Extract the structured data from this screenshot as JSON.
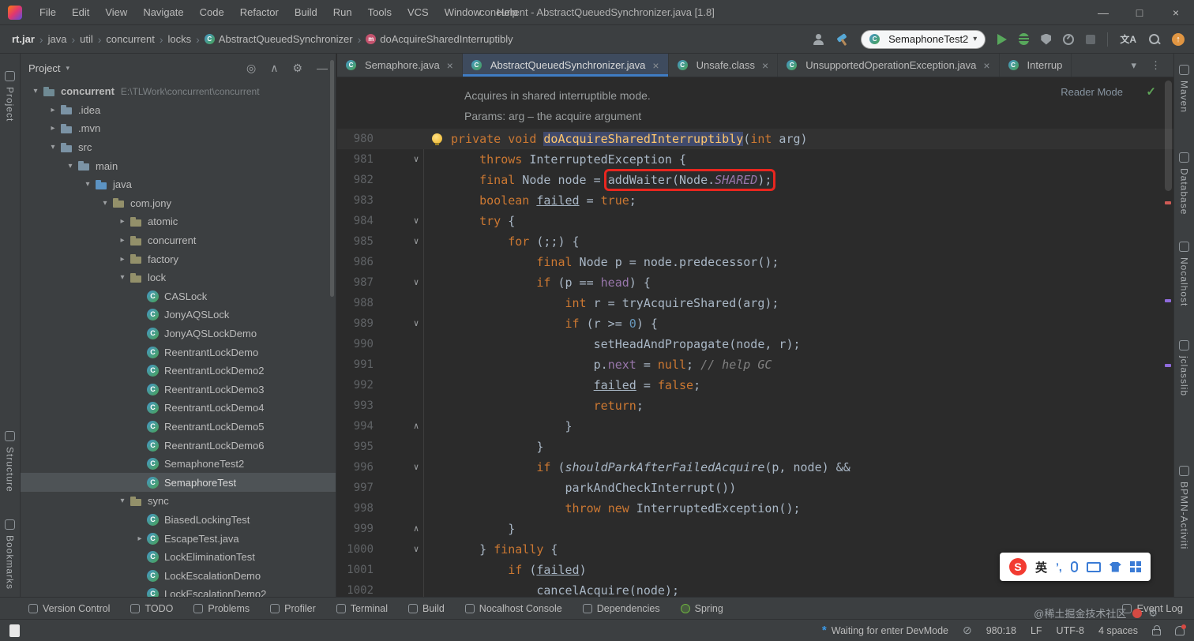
{
  "window": {
    "title": "concurrent - AbstractQueuedSynchronizer.java [1.8]",
    "menus": [
      "File",
      "Edit",
      "View",
      "Navigate",
      "Code",
      "Refactor",
      "Build",
      "Run",
      "Tools",
      "VCS",
      "Window",
      "Help"
    ]
  },
  "icons": {
    "class_letter": "C",
    "method_letter": "m",
    "tree_open": "▾",
    "tree_closed": "▸",
    "crumb_sep": "›",
    "tab_close": "×",
    "fold_open": "∨",
    "fold_closed": "∧",
    "chevron_down": "▾",
    "more_vertical": "⋮",
    "minimize": "—",
    "maximize": "□",
    "close": "×",
    "check": "✓",
    "locate": "◎",
    "collapse_all": "∧",
    "settings_gear": "⚙",
    "hide": "—",
    "translate": "文A",
    "update_arrow": "↑",
    "no_inspection": "⊘",
    "devmode_star": "*"
  },
  "toolbar": {
    "breadcrumbs": [
      {
        "label": "rt.jar",
        "bold": true
      },
      {
        "label": "java"
      },
      {
        "label": "util"
      },
      {
        "label": "concurrent"
      },
      {
        "label": "locks"
      },
      {
        "label": "AbstractQueuedSynchronizer",
        "icon": "class"
      },
      {
        "label": "doAcquireSharedInterruptibly",
        "icon": "method"
      }
    ],
    "run_config": "SemaphoneTest2"
  },
  "project_panel": {
    "title": "Project",
    "tree": [
      {
        "label": "concurrent",
        "suffix": "E:\\TLWork\\concurrent\\concurrent",
        "level": 0,
        "arrow": "open",
        "icon": "module",
        "bold": true
      },
      {
        "label": ".idea",
        "level": 1,
        "arrow": "closed",
        "icon": "folder"
      },
      {
        "label": ".mvn",
        "level": 1,
        "arrow": "closed",
        "icon": "folder"
      },
      {
        "label": "src",
        "level": 1,
        "arrow": "open",
        "icon": "folder"
      },
      {
        "label": "main",
        "level": 2,
        "arrow": "open",
        "icon": "folder"
      },
      {
        "label": "java",
        "level": 3,
        "arrow": "open",
        "icon": "srcfolder"
      },
      {
        "label": "com.jony",
        "level": 4,
        "arrow": "open",
        "icon": "package"
      },
      {
        "label": "atomic",
        "level": 5,
        "arrow": "closed",
        "icon": "package"
      },
      {
        "label": "concurrent",
        "level": 5,
        "arrow": "closed",
        "icon": "package"
      },
      {
        "label": "factory",
        "level": 5,
        "arrow": "closed",
        "icon": "package"
      },
      {
        "label": "lock",
        "level": 5,
        "arrow": "open",
        "icon": "package"
      },
      {
        "label": "CASLock",
        "level": 6,
        "icon": "class"
      },
      {
        "label": "JonyAQSLock",
        "level": 6,
        "icon": "class"
      },
      {
        "label": "JonyAQSLockDemo",
        "level": 6,
        "icon": "class"
      },
      {
        "label": "ReentrantLockDemo",
        "level": 6,
        "icon": "class"
      },
      {
        "label": "ReentrantLockDemo2",
        "level": 6,
        "icon": "class"
      },
      {
        "label": "ReentrantLockDemo3",
        "level": 6,
        "icon": "class"
      },
      {
        "label": "ReentrantLockDemo4",
        "level": 6,
        "icon": "class"
      },
      {
        "label": "ReentrantLockDemo5",
        "level": 6,
        "icon": "class"
      },
      {
        "label": "ReentrantLockDemo6",
        "level": 6,
        "icon": "class"
      },
      {
        "label": "SemaphoneTest2",
        "level": 6,
        "icon": "class"
      },
      {
        "label": "SemaphoreTest",
        "level": 6,
        "icon": "class",
        "selected": true
      },
      {
        "label": "sync",
        "level": 5,
        "arrow": "open",
        "icon": "package"
      },
      {
        "label": "BiasedLockingTest",
        "level": 6,
        "icon": "class"
      },
      {
        "label": "EscapeTest.java",
        "level": 6,
        "arrow": "closed",
        "icon": "class"
      },
      {
        "label": "LockEliminationTest",
        "level": 6,
        "icon": "class"
      },
      {
        "label": "LockEscalationDemo",
        "level": 6,
        "icon": "class"
      },
      {
        "label": "LockEscalationDemo2",
        "level": 6,
        "icon": "class"
      }
    ]
  },
  "editor": {
    "tabs": [
      {
        "label": "Semaphore.java",
        "active": false
      },
      {
        "label": "AbstractQueuedSynchronizer.java",
        "active": true
      },
      {
        "label": "Unsafe.class",
        "active": false
      },
      {
        "label": "UnsupportedOperationException.java",
        "active": false
      },
      {
        "label": "Interrup",
        "active": false,
        "closable": false
      }
    ],
    "reader_mode": "Reader Mode",
    "doc_lines": [
      "Acquires in shared interruptible mode.",
      "Params:  arg – the acquire argument"
    ],
    "code": [
      {
        "n": "980",
        "current": true,
        "bulb": true,
        "s": [
          {
            "t": "private",
            "c": "k"
          },
          {
            "t": " "
          },
          {
            "t": "void",
            "c": "k"
          },
          {
            "t": " "
          },
          {
            "t": "doAcquireSharedInterruptibly",
            "c": "d hl"
          },
          {
            "t": "("
          },
          {
            "t": "int",
            "c": "k"
          },
          {
            "t": " arg)"
          }
        ]
      },
      {
        "n": "981",
        "fold": "v",
        "s": [
          {
            "t": "    "
          },
          {
            "t": "throws",
            "c": "k"
          },
          {
            "t": " InterruptedException {"
          }
        ]
      },
      {
        "n": "982",
        "s": [
          {
            "t": "    "
          },
          {
            "t": "final",
            "c": "k"
          },
          {
            "t": " Node node = "
          },
          {
            "box": [
              {
                "t": "addWaiter(Node."
              },
              {
                "t": "SHARED",
                "c": "sf"
              },
              {
                "t": ");"
              }
            ]
          }
        ]
      },
      {
        "n": "983",
        "s": [
          {
            "t": "    "
          },
          {
            "t": "boolean",
            "c": "k"
          },
          {
            "t": " "
          },
          {
            "t": "failed",
            "c": "u"
          },
          {
            "t": " = "
          },
          {
            "t": "true",
            "c": "k"
          },
          {
            "t": ";"
          }
        ]
      },
      {
        "n": "984",
        "fold": "v",
        "s": [
          {
            "t": "    "
          },
          {
            "t": "try",
            "c": "k"
          },
          {
            "t": " {"
          }
        ]
      },
      {
        "n": "985",
        "fold": "v",
        "s": [
          {
            "t": "        "
          },
          {
            "t": "for",
            "c": "k"
          },
          {
            "t": " (;;) {"
          }
        ]
      },
      {
        "n": "986",
        "s": [
          {
            "t": "            "
          },
          {
            "t": "final",
            "c": "k"
          },
          {
            "t": " Node p = node.predecessor();"
          }
        ]
      },
      {
        "n": "987",
        "fold": "v",
        "s": [
          {
            "t": "            "
          },
          {
            "t": "if",
            "c": "k"
          },
          {
            "t": " (p == "
          },
          {
            "t": "head",
            "c": "f"
          },
          {
            "t": ") {"
          }
        ]
      },
      {
        "n": "988",
        "s": [
          {
            "t": "                "
          },
          {
            "t": "int",
            "c": "k"
          },
          {
            "t": " r = tryAcquireShared(arg);"
          }
        ]
      },
      {
        "n": "989",
        "fold": "v",
        "s": [
          {
            "t": "                "
          },
          {
            "t": "if",
            "c": "k"
          },
          {
            "t": " (r >= "
          },
          {
            "t": "0",
            "c": "n"
          },
          {
            "t": ") {"
          }
        ]
      },
      {
        "n": "990",
        "s": [
          {
            "t": "                    setHeadAndPropagate(node, r);"
          }
        ]
      },
      {
        "n": "991",
        "s": [
          {
            "t": "                    p."
          },
          {
            "t": "next",
            "c": "f"
          },
          {
            "t": " = "
          },
          {
            "t": "null",
            "c": "k"
          },
          {
            "t": "; "
          },
          {
            "t": "// help GC",
            "c": "c"
          }
        ]
      },
      {
        "n": "992",
        "s": [
          {
            "t": "                    "
          },
          {
            "t": "failed",
            "c": "u"
          },
          {
            "t": " = "
          },
          {
            "t": "false",
            "c": "k"
          },
          {
            "t": ";"
          }
        ]
      },
      {
        "n": "993",
        "s": [
          {
            "t": "                    "
          },
          {
            "t": "return",
            "c": "k"
          },
          {
            "t": ";"
          }
        ]
      },
      {
        "n": "994",
        "fold": "c",
        "s": [
          {
            "t": "                }"
          }
        ]
      },
      {
        "n": "995",
        "s": [
          {
            "t": "            }"
          }
        ]
      },
      {
        "n": "996",
        "fold": "v",
        "s": [
          {
            "t": "            "
          },
          {
            "t": "if",
            "c": "k"
          },
          {
            "t": " ("
          },
          {
            "t": "shouldParkAfterFailedAcquire",
            "c": "i"
          },
          {
            "t": "(p, node) &&"
          }
        ]
      },
      {
        "n": "997",
        "s": [
          {
            "t": "                parkAndCheckInterrupt())"
          }
        ]
      },
      {
        "n": "998",
        "s": [
          {
            "t": "                "
          },
          {
            "t": "throw",
            "c": "k"
          },
          {
            "t": " "
          },
          {
            "t": "new",
            "c": "k"
          },
          {
            "t": " InterruptedException();"
          }
        ]
      },
      {
        "n": "999",
        "fold": "c",
        "s": [
          {
            "t": "        }"
          }
        ]
      },
      {
        "n": "1000",
        "fold": "v",
        "s": [
          {
            "t": "    } "
          },
          {
            "t": "finally",
            "c": "k"
          },
          {
            "t": " {"
          }
        ]
      },
      {
        "n": "1001",
        "s": [
          {
            "t": "        "
          },
          {
            "t": "if",
            "c": "k"
          },
          {
            "t": " ("
          },
          {
            "t": "failed",
            "c": "u"
          },
          {
            "t": ")"
          }
        ]
      },
      {
        "n": "1002",
        "s": [
          {
            "t": "            cancelAcquire(node);"
          }
        ]
      }
    ]
  },
  "tool_windows": {
    "left": [
      "Project",
      "Structure",
      "Bookmarks"
    ],
    "right": [
      "Maven",
      "Database",
      "Nocalhost",
      "jclasslib",
      "BPMN-Activiti"
    ]
  },
  "status_bar": {
    "toolwindow_buttons": [
      "Version Control",
      "TODO",
      "Problems",
      "Profiler",
      "Terminal",
      "Build",
      "Nocalhost Console",
      "Dependencies",
      "Spring"
    ],
    "event_log": "Event Log",
    "devmode": "Waiting for enter DevMode",
    "caret": "980:18",
    "line_ending": "LF",
    "encoding": "UTF-8",
    "indent": "4 spaces"
  },
  "watermark": {
    "text": "@稀土掘金技术社区"
  },
  "ime": {
    "lang": "英"
  },
  "colors": {
    "editor_bg": "#2b2b2b",
    "panel_bg": "#3c3f41",
    "keyword": "#cc7832",
    "method_decl": "#ffc66b",
    "field": "#9876aa",
    "number": "#6897bb",
    "comment": "#808080",
    "annotation_box": "#e8261f",
    "active_tab_underline": "#3f7cc4",
    "selection_bg": "#4e5356"
  }
}
